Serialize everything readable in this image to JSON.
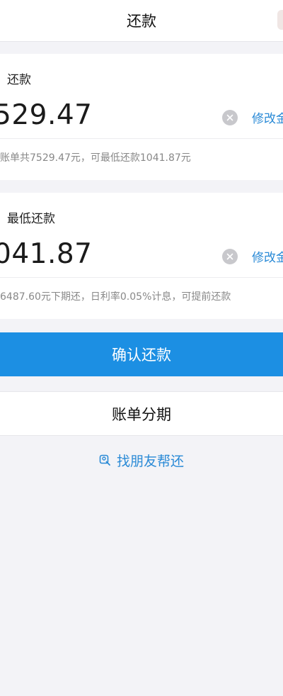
{
  "header": {
    "title": "还款"
  },
  "full_repayment": {
    "label": "还款",
    "amount": "529.47",
    "modify_label": "修改金",
    "hint": "账单共7529.47元，可最低还款1041.87元"
  },
  "min_repayment": {
    "label": "最低还款",
    "amount": "041.87",
    "modify_label": "修改金",
    "hint": "6487.60元下期还，日利率0.05%计息，可提前还款"
  },
  "actions": {
    "confirm_label": "确认还款",
    "installment_label": "账单分期",
    "friend_label": "找朋友帮还"
  },
  "icons": {
    "clear": "clear-circle-icon",
    "friend": "friend-help-icon"
  },
  "colors": {
    "primary": "#1c8fe3",
    "link": "#2a8ad6",
    "background": "#f3f3f7"
  }
}
